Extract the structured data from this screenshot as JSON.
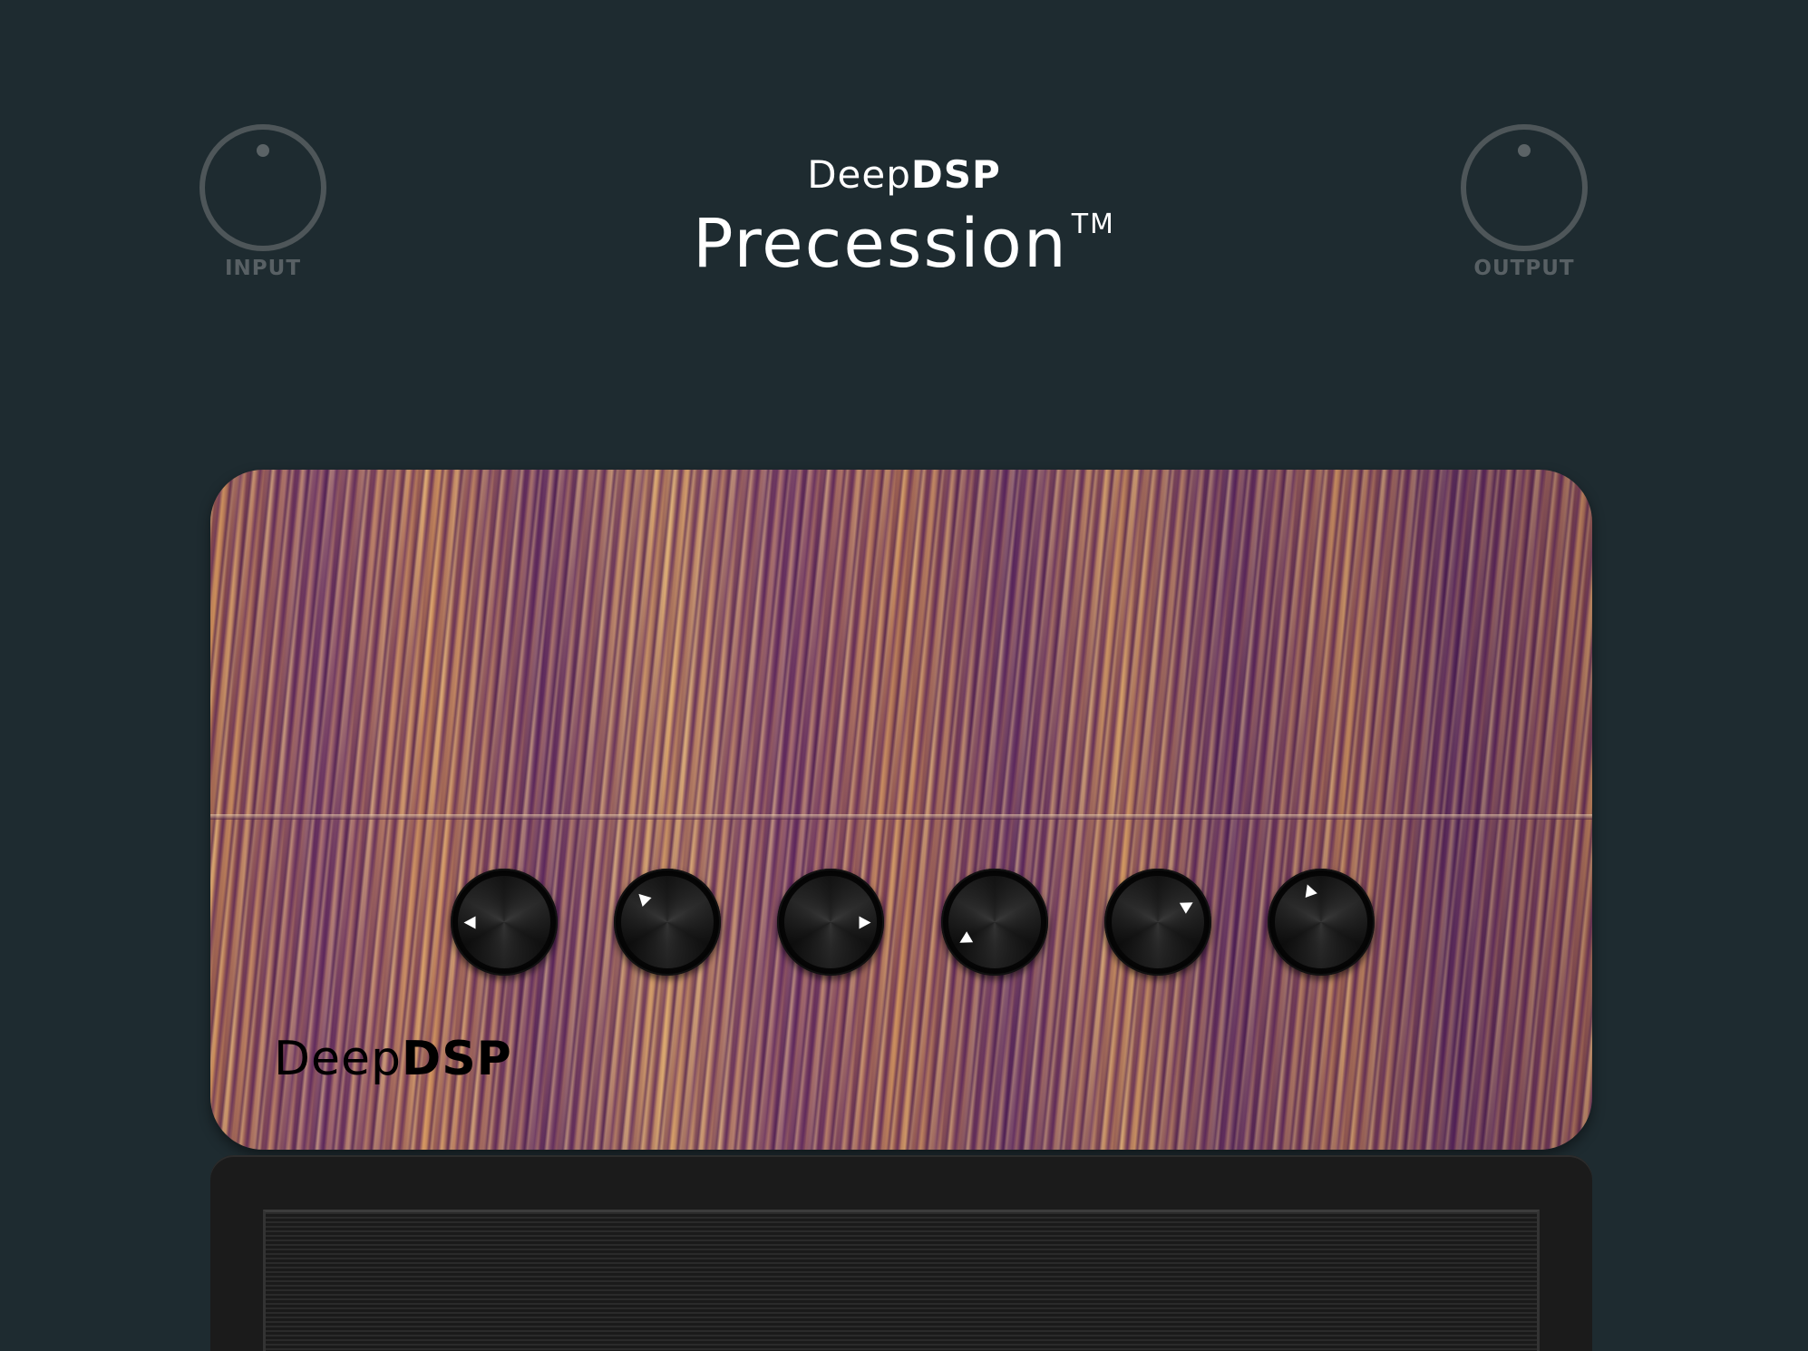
{
  "header": {
    "brand_light": "Deep",
    "brand_bold": "DSP",
    "product_name": "Precession",
    "trademark": "TM"
  },
  "input_knob": {
    "label": "INPUT",
    "icon": "knob-icon"
  },
  "output_knob": {
    "label": "OUTPUT",
    "icon": "knob-icon"
  },
  "amp": {
    "logo_light": "Deep",
    "logo_bold": "DSP",
    "knob_count": 6,
    "knob_pointer_angles_deg": [
      -90,
      -45,
      90,
      -120,
      60,
      -20
    ]
  },
  "colors": {
    "background": "#1e2b30",
    "title_text": "#ffffff",
    "io_label": "#586064",
    "io_ring": "#4e5659",
    "knob_black": "#050505",
    "wood_light": "#e0a35e",
    "wood_dark": "#5e2c60"
  }
}
